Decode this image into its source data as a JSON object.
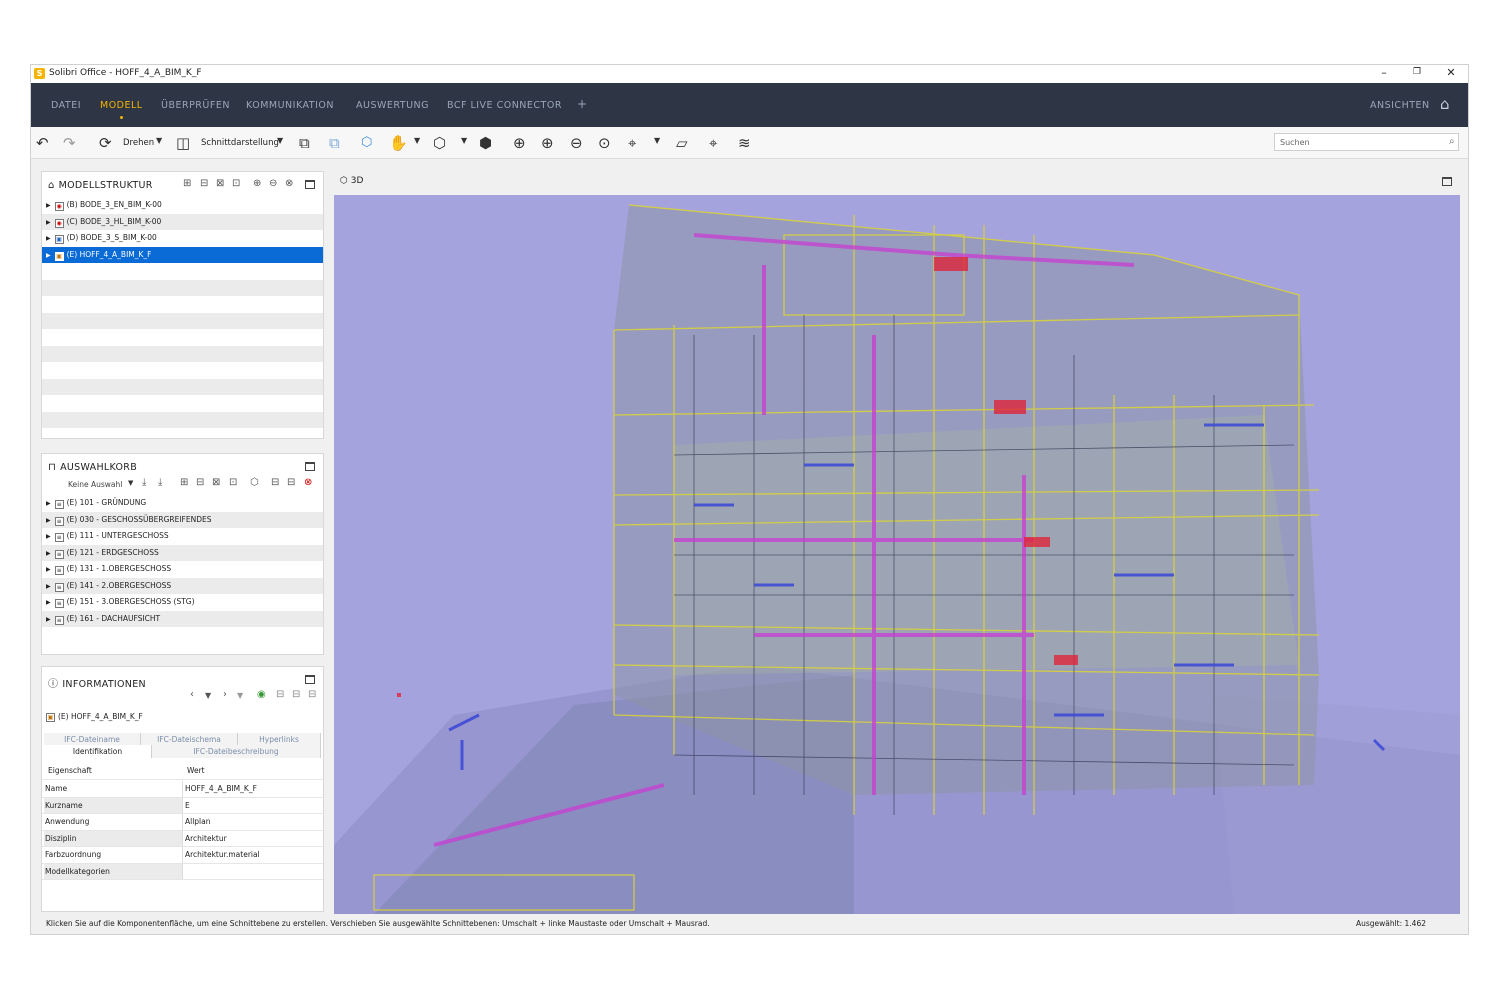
{
  "window": {
    "title": "Solibri Office - HOFF_4_A_BIM_K_F",
    "minimize": "–",
    "restore": "❐",
    "close": "✕"
  },
  "menu": {
    "items": [
      "DATEI",
      "MODELL",
      "ÜBERPRÜFEN",
      "KOMMUNIKATION",
      "AUSWERTUNG",
      "BCF LIVE CONNECTOR",
      "+"
    ],
    "active": "MODELL",
    "right": "ANSICHTEN"
  },
  "toolbar": {
    "rotate_label": "Drehen",
    "section_label": "Schnittdarstellung",
    "search_placeholder": "Suchen"
  },
  "model_structure": {
    "title": "MODELLSTRUKTUR",
    "items": [
      "(B) BODE_3_EN_BIM_K-00",
      "(C) BODE_3_HL_BIM_K-00",
      "(D) BODE_3_S_BIM_K-00",
      "(E) HOFF_4_A_BIM_K_F"
    ],
    "selected_index": 3
  },
  "basket": {
    "title": "AUSWAHLKORB",
    "dropdown": "Keine Auswahl",
    "items": [
      "(E) 101 - GRÜNDUNG",
      "(E) 030 - GESCHOSSÜBERGREIFENDES",
      "(E) 111 - UNTERGESCHOSS",
      "(E) 121 - ERDGESCHOSS",
      "(E) 131 - 1.OBERGESCHOSS",
      "(E) 141 - 2.OBERGESCHOSS",
      "(E) 151 - 3.OBERGESCHOSS (STG)",
      "(E) 161 - DACHAUFSICHT"
    ]
  },
  "info": {
    "title": "INFORMATIONEN",
    "model": "(E) HOFF_4_A_BIM_K_F",
    "tabs_top": [
      "IFC-Dateiname",
      "IFC-Dateischema",
      "Hyperlinks"
    ],
    "tabs_bottom": [
      "Identifikation",
      "IFC-Dateibeschreibung"
    ],
    "header": {
      "key": "Eigenschaft",
      "value": "Wert"
    },
    "rows": [
      {
        "key": "Name",
        "value": "HOFF_4_A_BIM_K_F"
      },
      {
        "key": "Kurzname",
        "value": "E"
      },
      {
        "key": "Anwendung",
        "value": "Allplan"
      },
      {
        "key": "Disziplin",
        "value": "Architektur"
      },
      {
        "key": "Farbzuordnung",
        "value": "Architektur.material"
      },
      {
        "key": "Modellkategorien",
        "value": ""
      }
    ]
  },
  "viewport": {
    "label": "3D",
    "background": "#a5a3dd"
  },
  "status": {
    "hint": "Klicken Sie auf die Komponentenfläche, um eine Schnittebene zu erstellen. Verschieben Sie ausgewählte Schnittebenen: Umschalt + linke Maustaste oder Umschalt + Mausrad.",
    "selected": "Ausgewählt: 1.462"
  },
  "colors": {
    "menubar": "#2e3646",
    "accent": "#f5b400",
    "selection": "#0a6ad6",
    "wire_yellow": "#d8d23a",
    "wire_magenta": "#c83cd2",
    "wire_blue": "#3a46d6"
  }
}
